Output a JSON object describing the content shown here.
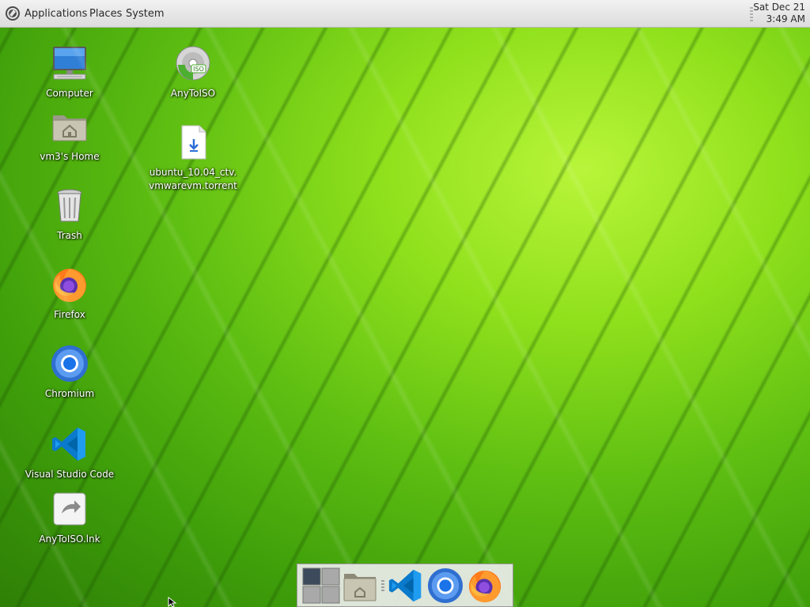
{
  "top_panel": {
    "menu": {
      "applications": "Applications",
      "places": "Places",
      "system": "System"
    },
    "clock": {
      "date": "Sat Dec 21",
      "time": "3:49 AM"
    }
  },
  "desktop_icons": {
    "computer": "Computer",
    "home": "vm3's Home",
    "trash": "Trash",
    "firefox": "Firefox",
    "chromium": "Chromium",
    "vscode": "Visual Studio Code",
    "anytoiso_lnk": "AnyToISO.lnk",
    "anytoiso": "AnyToISO",
    "torrent": "ubuntu_10.04_ctv.\nvmwarevm.torrent"
  },
  "dock": {
    "items": [
      "workspace-switcher",
      "files",
      "visual-studio-code",
      "chromium",
      "firefox"
    ]
  },
  "colors": {
    "panel_bg": "#e6e6e6",
    "wallpaper_green": "#7ed321",
    "vscode_blue": "#0a7acc",
    "chromium_blue": "#1a73e8"
  }
}
